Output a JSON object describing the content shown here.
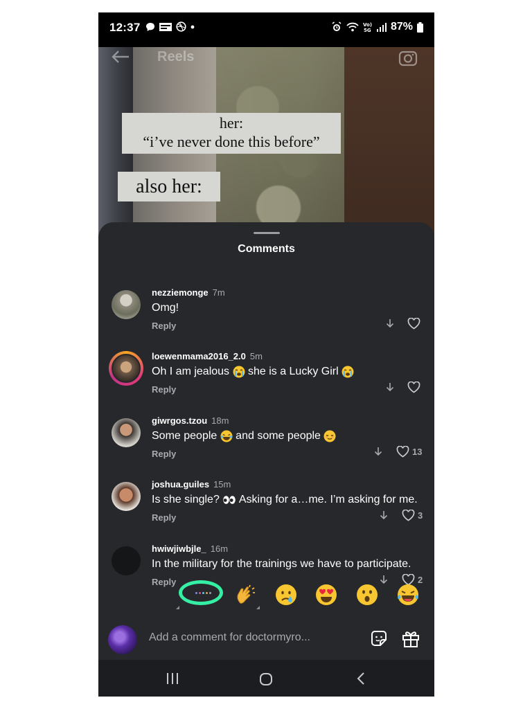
{
  "status_bar": {
    "time": "12:37",
    "battery": "87%"
  },
  "video": {
    "title": "Reels",
    "caption_line_1": "her:",
    "caption_line_2": "“i’ve never done this before”",
    "caption_2": "also her:"
  },
  "comments_sheet": {
    "title": "Comments",
    "comments": [
      {
        "username": "nezziemonge",
        "time": "7m",
        "text": "Omg!",
        "reply": "Reply",
        "likes": ""
      },
      {
        "username": "loewenmama2016_2.0",
        "time": "5m",
        "text_before": "Oh I am jealous ",
        "text_middle": " she is a Lucky Girl ",
        "reply": "Reply",
        "likes": ""
      },
      {
        "username": "giwrgos.tzou",
        "time": "18m",
        "text_before": "Some people ",
        "text_middle": " and some people ",
        "reply": "Reply",
        "likes": "13"
      },
      {
        "username": "joshua.guiles",
        "time": "15m",
        "text_before": "Is she single? ",
        "text_after": " Asking for a…me. I’m asking for me.",
        "reply": "Reply",
        "likes": "3"
      },
      {
        "username": "hwiwjiwbjle_",
        "time": "16m",
        "text": "In the military for the trainings we have to participate.",
        "reply": "Reply",
        "likes": "2"
      }
    ]
  },
  "reactions": [
    "clapping-hands",
    "crying-face",
    "heart-eyes",
    "surprised-face",
    "tears-of-joy"
  ],
  "add_comment": {
    "placeholder": "Add a comment for doctormyro..."
  },
  "colors": {
    "sheet_bg": "#26282c",
    "highlight_circle": "#35f0a4",
    "secondary_text": "#a8aab0"
  }
}
